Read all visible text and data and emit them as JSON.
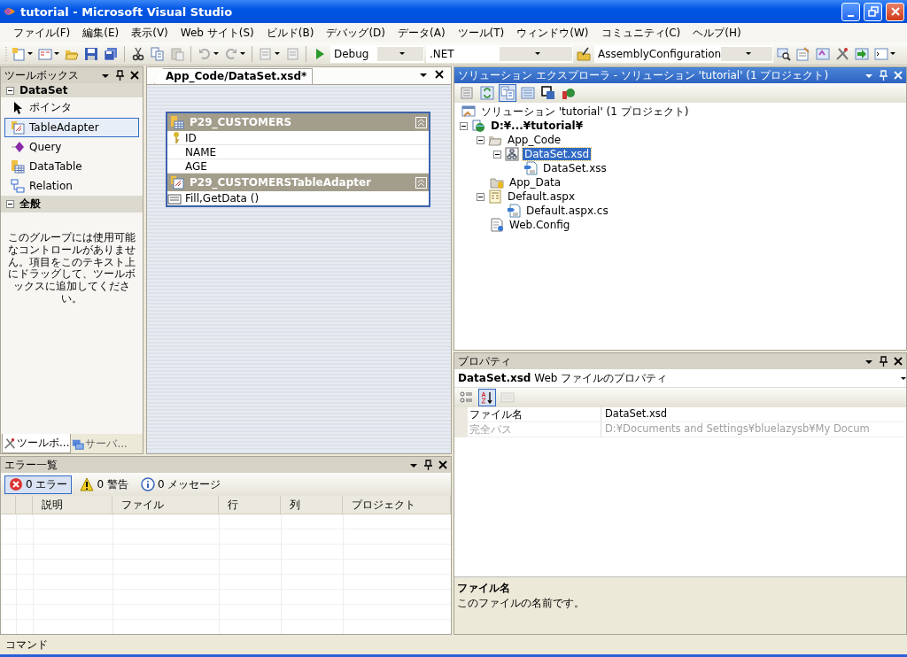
{
  "window": {
    "title": "tutorial - Microsoft Visual Studio"
  },
  "menu": [
    "ファイル(F)",
    "編集(E)",
    "表示(V)",
    "Web サイト(S)",
    "ビルド(B)",
    "デバッグ(D)",
    "データ(A)",
    "ツール(T)",
    "ウィンドウ(W)",
    "コミュニティ(C)",
    "ヘルプ(H)"
  ],
  "toolbar": {
    "configuration": "Debug",
    "platform": ".NET",
    "startup": "AssemblyConfiguration"
  },
  "toolbox": {
    "title": "ツールボックス",
    "groups": [
      {
        "label": "DataSet",
        "expanded": true,
        "items": [
          {
            "label": "ポインタ",
            "selected": false
          },
          {
            "label": "TableAdapter",
            "selected": true
          },
          {
            "label": "Query",
            "selected": false
          },
          {
            "label": "DataTable",
            "selected": false
          },
          {
            "label": "Relation",
            "selected": false
          }
        ]
      },
      {
        "label": "全般",
        "expanded": true,
        "empty_message": "このグループには使用可能なコントロールがありません。項目をこのテキスト上にドラッグして、ツールボックスに追加してください。"
      }
    ],
    "tabs": [
      {
        "label": "ツールボ...",
        "selected": true
      },
      {
        "label": "サーバ...",
        "selected": false
      }
    ]
  },
  "designer": {
    "tab": "App_Code/DataSet.xsd*",
    "table": {
      "name": "P29_CUSTOMERS",
      "columns": [
        {
          "name": "ID",
          "key": true
        },
        {
          "name": "NAME",
          "key": false
        },
        {
          "name": "AGE",
          "key": false
        }
      ],
      "adapter": "P29_CUSTOMERSTableAdapter",
      "queries": [
        "Fill,GetData ()"
      ]
    }
  },
  "error_list": {
    "title": "エラー一覧",
    "filters": [
      {
        "kind": "error",
        "label": "0 エラー",
        "selected": true
      },
      {
        "kind": "warning",
        "label": "0 警告",
        "selected": false
      },
      {
        "kind": "info",
        "label": "0 メッセージ",
        "selected": false
      }
    ],
    "columns": [
      "説明",
      "ファイル",
      "行",
      "列",
      "プロジェクト"
    ]
  },
  "solution_explorer": {
    "title": "ソリューション エクスプローラ - ソリューション 'tutorial' (1 プロジェクト)",
    "toolbar_buttons": [
      {
        "selected": false
      },
      {
        "selected": false
      },
      {
        "selected": true
      },
      {
        "selected": false
      },
      {
        "selected": false
      },
      {
        "selected": false
      }
    ],
    "solution": {
      "label": "ソリューション 'tutorial' (1 プロジェクト)",
      "children": [
        {
          "kind": "website",
          "label": "D:¥...¥tutorial¥",
          "expanded": true,
          "selected": false,
          "children": [
            {
              "kind": "folder",
              "label": "App_Code",
              "expanded": true,
              "selected": false,
              "children": [
                {
                  "kind": "dataset",
                  "label": "DataSet.xsd",
                  "expanded": true,
                  "selected": true,
                  "children": [
                    {
                      "kind": "codefile",
                      "label": "DataSet.xss",
                      "selected": false
                    }
                  ]
                }
              ]
            },
            {
              "kind": "datafolder",
              "label": "App_Data",
              "selected": false
            },
            {
              "kind": "page",
              "label": "Default.aspx",
              "expanded": true,
              "selected": false,
              "children": [
                {
                  "kind": "codefile",
                  "label": "Default.aspx.cs",
                  "selected": false
                }
              ]
            },
            {
              "kind": "config",
              "label": "Web.Config",
              "selected": false
            }
          ]
        }
      ]
    }
  },
  "properties": {
    "title": "プロパティ",
    "object": "**DataSet.xsd** Web ファイルのプロパティ",
    "sort_buttons": [
      {
        "selected": false
      },
      {
        "selected": true
      },
      {
        "selected": false,
        "disabled": true
      }
    ],
    "rows": [
      {
        "name": "ファイル名",
        "value": "DataSet.xsd",
        "disabled": false
      },
      {
        "name": "完全パス",
        "value": "D:¥Documents and Settings¥bluelazysb¥My Docum",
        "disabled": true
      }
    ],
    "description": {
      "title": "ファイル名",
      "text": "このファイルの名前です。"
    }
  },
  "command_bar": {
    "label": "コマンド"
  }
}
